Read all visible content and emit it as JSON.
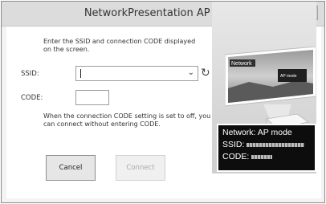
{
  "window": {
    "title": "NetworkPresentation AP Mode",
    "close_label": "×"
  },
  "form": {
    "description": "Enter the SSID and connection CODE displayed on the screen.",
    "ssid_label": "SSID:",
    "ssid_value": "",
    "code_label": "CODE:",
    "code_value": "",
    "note": "When the connection CODE setting is set to off, you can connect without entering CODE."
  },
  "buttons": {
    "cancel": "Cancel",
    "connect": "Connect"
  },
  "illustration": {
    "screen_label": "Network",
    "screen_text": "AP mode",
    "info_line1": "Network: AP mode",
    "info_ssid_label": "SSID:",
    "info_code_label": "CODE:"
  },
  "icons": {
    "refresh": "refresh-icon",
    "dropdown": "chevron-down-icon",
    "close": "close-icon"
  }
}
